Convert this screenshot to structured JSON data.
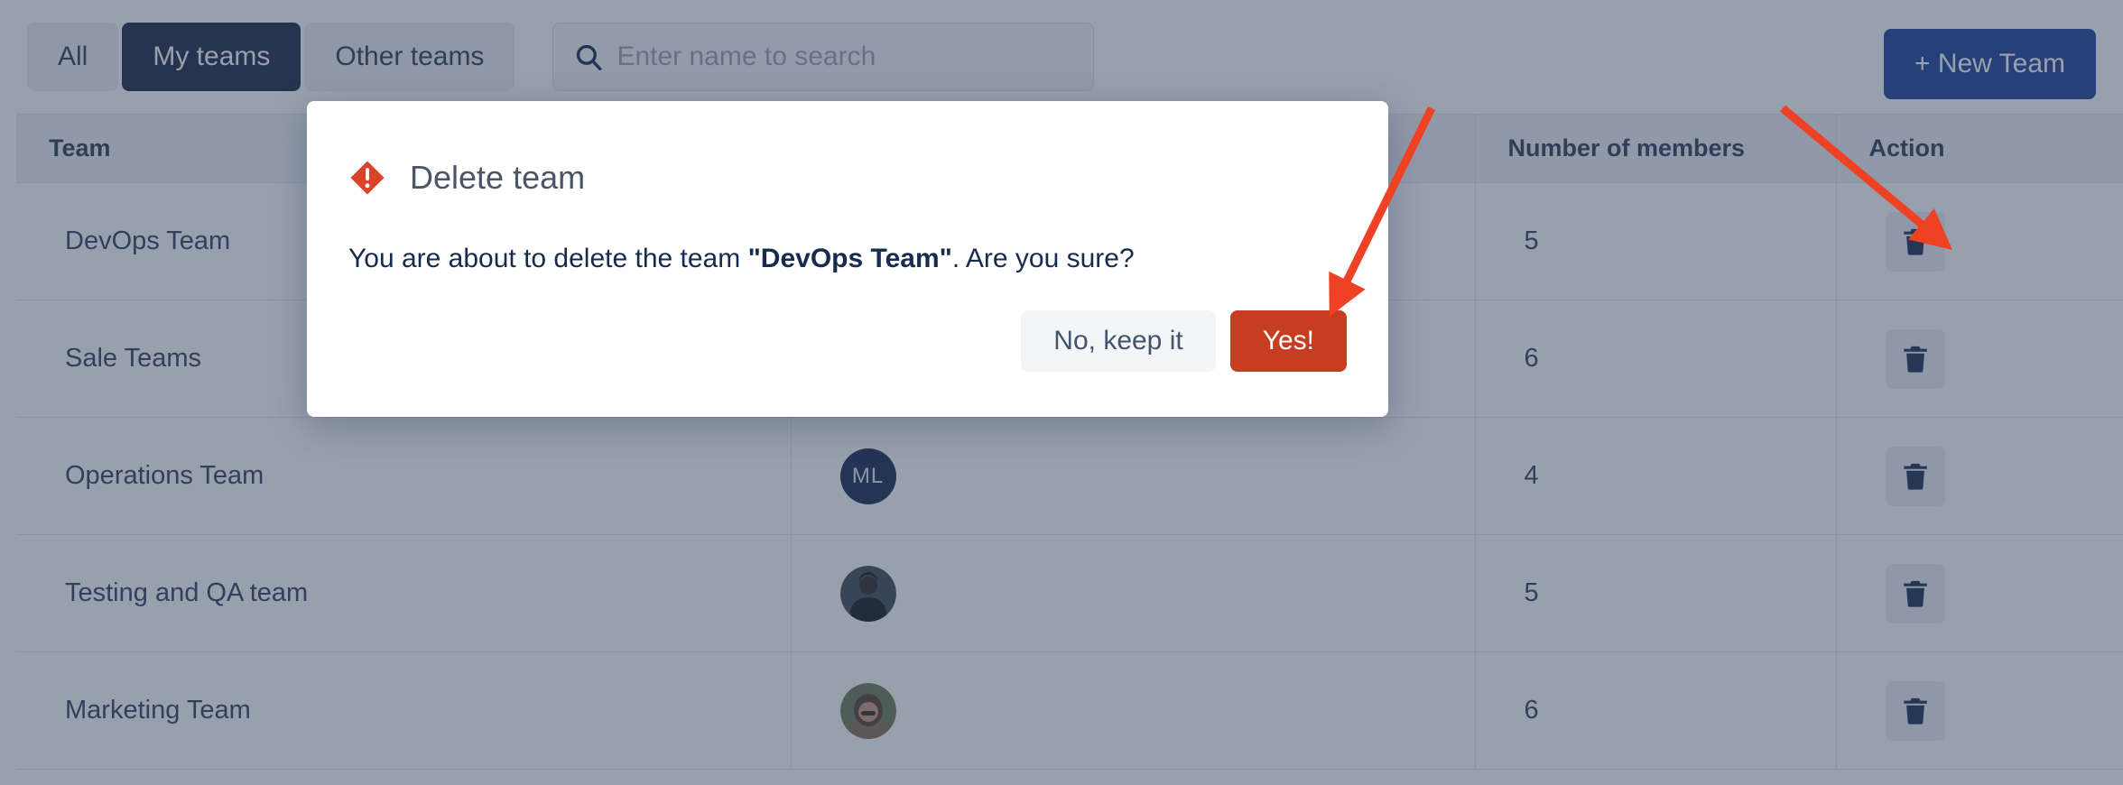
{
  "toolbar": {
    "tabs": [
      {
        "label": "All",
        "active": false
      },
      {
        "label": "My teams",
        "active": true
      },
      {
        "label": "Other teams",
        "active": false
      }
    ],
    "search": {
      "placeholder": "Enter name to search",
      "value": ""
    },
    "new_team_label": "+ New Team"
  },
  "table": {
    "columns": [
      "Team",
      "",
      "Number of members",
      "Action"
    ],
    "rows": [
      {
        "team": "DevOps Team",
        "lead": {
          "type": "none",
          "initials": ""
        },
        "members": "5",
        "action": "delete-icon"
      },
      {
        "team": "Sale Teams",
        "lead": {
          "type": "none",
          "initials": ""
        },
        "members": "6",
        "action": "delete-icon"
      },
      {
        "team": "Operations Team",
        "lead": {
          "type": "initials",
          "initials": "ML"
        },
        "members": "4",
        "action": "delete-icon"
      },
      {
        "team": "Testing and QA team",
        "lead": {
          "type": "photo",
          "initials": ""
        },
        "members": "5",
        "action": "delete-icon"
      },
      {
        "team": "Marketing Team",
        "lead": {
          "type": "photo",
          "initials": ""
        },
        "members": "6",
        "action": "delete-icon"
      }
    ]
  },
  "modal": {
    "title": "Delete team",
    "icon": "warning-diamond-icon",
    "message_prefix": "You are about to delete the team ",
    "message_team": "\"DevOps Team\"",
    "message_suffix": ". Are you sure?",
    "cancel_label": "No, keep it",
    "confirm_label": "Yes!"
  },
  "annotations": {
    "arrow_color": "#ef4123",
    "arrows": [
      {
        "name": "arrow-to-confirm-button"
      },
      {
        "name": "arrow-to-delete-row-icon"
      }
    ]
  },
  "colors": {
    "accent_blue": "#1b4298",
    "active_tab": "#1b2845",
    "danger": "#c63d22",
    "warning_icon": "#d9432a",
    "overlay": "#323f5c",
    "avatar_bg": "#16284e"
  }
}
